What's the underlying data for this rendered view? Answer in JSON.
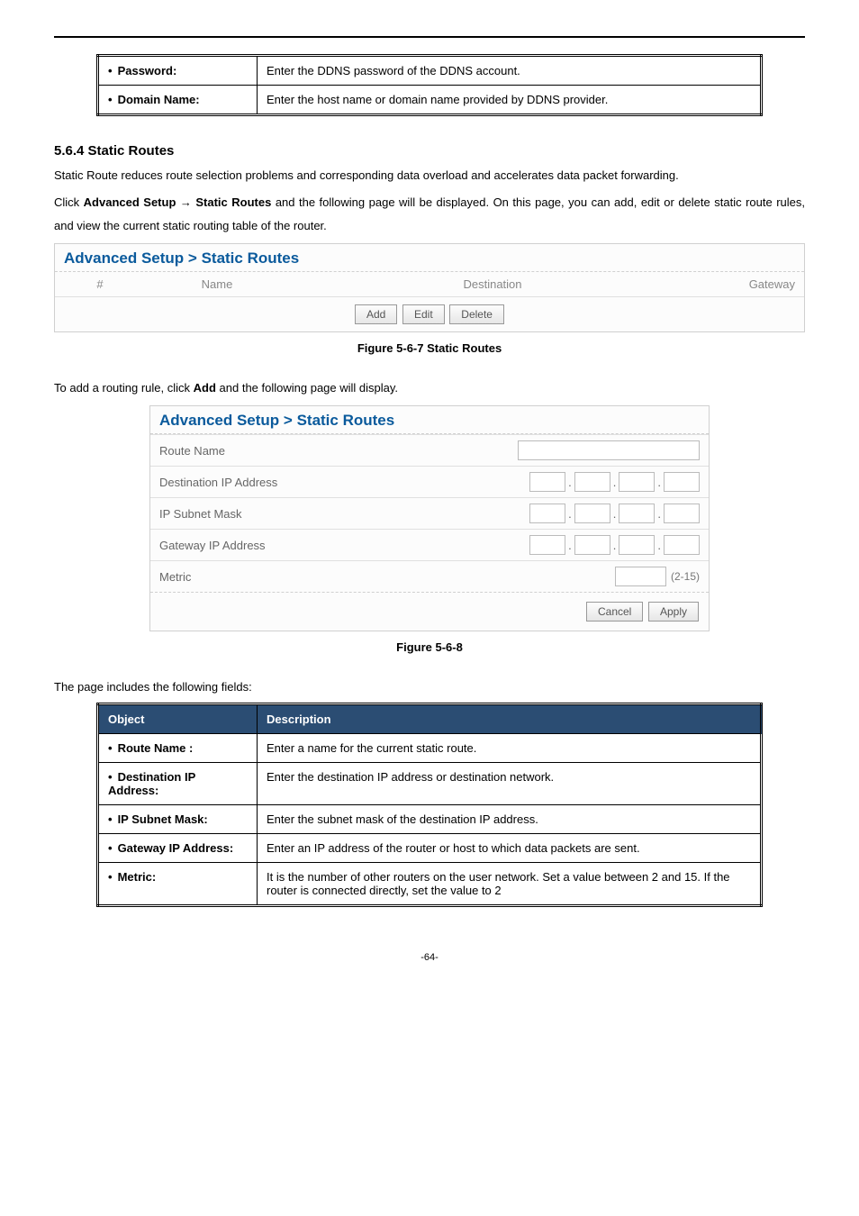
{
  "table1": {
    "rows": [
      {
        "obj": "Password:",
        "desc": "Enter the DDNS password of the DDNS account."
      },
      {
        "obj": "Domain Name:",
        "desc": "Enter the host name or domain name provided by DDNS provider."
      }
    ]
  },
  "section": {
    "heading": "5.6.4  Static Routes",
    "para1": "Static Route reduces route selection problems and corresponding data overload and accelerates data packet forwarding.",
    "para2_pre": "Click ",
    "para2_bold1": "Advanced Setup",
    "para2_arrow": " → ",
    "para2_bold2": "Static Routes",
    "para2_post": " and the following page will be displayed. On this page, you can add, edit or delete static route rules, and view the current static routing table of the router."
  },
  "fig1": {
    "title": "Advanced Setup > Static Routes",
    "cols": {
      "c1": "#",
      "c2": "Name",
      "c3": "Destination",
      "c4": "Gateway"
    },
    "btns": {
      "add": "Add",
      "edit": "Edit",
      "del": "Delete"
    },
    "caption": "Figure 5-6-7 Static Routes"
  },
  "after_fig1": {
    "pre": "To add a routing rule, click ",
    "bold": "Add",
    "post": " and the following page will display."
  },
  "fig2": {
    "title": "Advanced Setup > Static Routes",
    "rows": {
      "route_name": "Route Name",
      "dest_ip": "Destination IP Address",
      "subnet": "IP Subnet Mask",
      "gateway": "Gateway IP Address",
      "metric": "Metric",
      "metric_hint": "(2-15)"
    },
    "btns": {
      "cancel": "Cancel",
      "apply": "Apply"
    },
    "caption": "Figure 5-6-8"
  },
  "after_fig2": "The page includes the following fields:",
  "table2": {
    "head": {
      "obj": "Object",
      "desc": "Description"
    },
    "rows": [
      {
        "obj": "Route Name :",
        "desc": "Enter a name for the current static route."
      },
      {
        "obj": "Destination IP Address:",
        "desc": "Enter the destination IP address or destination network."
      },
      {
        "obj": "IP Subnet Mask:",
        "desc": "Enter the subnet mask of the destination IP address."
      },
      {
        "obj": "Gateway IP Address:",
        "desc": "Enter an IP address of the router or host to which data packets are sent."
      },
      {
        "obj": "Metric:",
        "desc": "It is the number of other routers on the user network. Set a value between 2 and 15. If the router is connected directly, set the value to 2"
      }
    ]
  },
  "page_num": "-64-"
}
